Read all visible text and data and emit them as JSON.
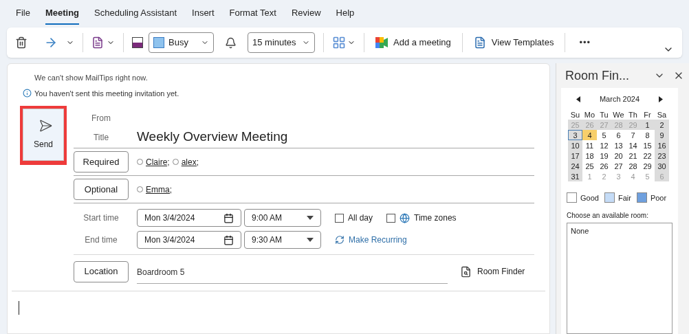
{
  "menu_tabs": [
    {
      "label": "File",
      "selected": false
    },
    {
      "label": "Meeting",
      "selected": true
    },
    {
      "label": "Scheduling Assistant",
      "selected": false
    },
    {
      "label": "Insert",
      "selected": false
    },
    {
      "label": "Format Text",
      "selected": false
    },
    {
      "label": "Review",
      "selected": false
    },
    {
      "label": "Help",
      "selected": false
    }
  ],
  "ribbon": {
    "show_as": {
      "value": "Busy",
      "color": "#8fc3ee"
    },
    "reminder": {
      "value": "15 minutes"
    },
    "add_meeting": "Add a meeting",
    "view_templates": "View Templates",
    "more": "•••"
  },
  "mailtips": {
    "notice": "We can't show MailTips right now.",
    "info": "You haven't sent this meeting invitation yet."
  },
  "send_button": {
    "label": "Send",
    "highlighted": true
  },
  "form": {
    "from_label": "From",
    "title_label": "Title",
    "title_value": "Weekly Overview Meeting",
    "required": {
      "label": "Required",
      "attendees": [
        "Claire;",
        "alex;"
      ]
    },
    "optional": {
      "label": "Optional",
      "attendees": [
        "Emma;"
      ]
    },
    "start_label": "Start time",
    "start_date": "Mon 3/4/2024",
    "start_time": "9:00 AM",
    "end_label": "End time",
    "end_date": "Mon 3/4/2024",
    "end_time": "9:30 AM",
    "all_day": {
      "label": "All day",
      "checked": false
    },
    "time_zones": {
      "label": "Time zones",
      "checked": false
    },
    "make_recurring": "Make Recurring",
    "location_label": "Location",
    "location_value": "Boardroom 5",
    "room_finder": "Room Finder"
  },
  "room_finder": {
    "title": "Room Fin...",
    "month": "March 2024",
    "weekdays": [
      "Su",
      "Mo",
      "Tu",
      "We",
      "Th",
      "Fr",
      "Sa"
    ],
    "weeks": [
      [
        {
          "label": "25",
          "muted": true,
          "shaded": true,
          "selected": false,
          "today": false
        },
        {
          "label": "26",
          "muted": true,
          "shaded": true,
          "selected": false,
          "today": false
        },
        {
          "label": "27",
          "muted": true,
          "shaded": true,
          "selected": false,
          "today": false
        },
        {
          "label": "28",
          "muted": true,
          "shaded": true,
          "selected": false,
          "today": false
        },
        {
          "label": "29",
          "muted": true,
          "shaded": true,
          "selected": false,
          "today": false
        },
        {
          "label": "1",
          "muted": false,
          "shaded": true,
          "selected": false,
          "today": false
        },
        {
          "label": "2",
          "muted": false,
          "shaded": true,
          "selected": false,
          "today": false
        }
      ],
      [
        {
          "label": "3",
          "muted": false,
          "shaded": true,
          "selected": true,
          "today": false
        },
        {
          "label": "4",
          "muted": false,
          "shaded": false,
          "selected": false,
          "today": true
        },
        {
          "label": "5",
          "muted": false,
          "shaded": false,
          "selected": false,
          "today": false
        },
        {
          "label": "6",
          "muted": false,
          "shaded": false,
          "selected": false,
          "today": false
        },
        {
          "label": "7",
          "muted": false,
          "shaded": false,
          "selected": false,
          "today": false
        },
        {
          "label": "8",
          "muted": false,
          "shaded": false,
          "selected": false,
          "today": false
        },
        {
          "label": "9",
          "muted": false,
          "shaded": true,
          "selected": false,
          "today": false
        }
      ],
      [
        {
          "label": "10",
          "muted": false,
          "shaded": true,
          "selected": false,
          "today": false
        },
        {
          "label": "11",
          "muted": false,
          "shaded": false,
          "selected": false,
          "today": false
        },
        {
          "label": "12",
          "muted": false,
          "shaded": false,
          "selected": false,
          "today": false
        },
        {
          "label": "13",
          "muted": false,
          "shaded": false,
          "selected": false,
          "today": false
        },
        {
          "label": "14",
          "muted": false,
          "shaded": false,
          "selected": false,
          "today": false
        },
        {
          "label": "15",
          "muted": false,
          "shaded": false,
          "selected": false,
          "today": false
        },
        {
          "label": "16",
          "muted": false,
          "shaded": true,
          "selected": false,
          "today": false
        }
      ],
      [
        {
          "label": "17",
          "muted": false,
          "shaded": true,
          "selected": false,
          "today": false
        },
        {
          "label": "18",
          "muted": false,
          "shaded": false,
          "selected": false,
          "today": false
        },
        {
          "label": "19",
          "muted": false,
          "shaded": false,
          "selected": false,
          "today": false
        },
        {
          "label": "20",
          "muted": false,
          "shaded": false,
          "selected": false,
          "today": false
        },
        {
          "label": "21",
          "muted": false,
          "shaded": false,
          "selected": false,
          "today": false
        },
        {
          "label": "22",
          "muted": false,
          "shaded": false,
          "selected": false,
          "today": false
        },
        {
          "label": "23",
          "muted": false,
          "shaded": true,
          "selected": false,
          "today": false
        }
      ],
      [
        {
          "label": "24",
          "muted": false,
          "shaded": true,
          "selected": false,
          "today": false
        },
        {
          "label": "25",
          "muted": false,
          "shaded": false,
          "selected": false,
          "today": false
        },
        {
          "label": "26",
          "muted": false,
          "shaded": false,
          "selected": false,
          "today": false
        },
        {
          "label": "27",
          "muted": false,
          "shaded": false,
          "selected": false,
          "today": false
        },
        {
          "label": "28",
          "muted": false,
          "shaded": false,
          "selected": false,
          "today": false
        },
        {
          "label": "29",
          "muted": false,
          "shaded": false,
          "selected": false,
          "today": false
        },
        {
          "label": "30",
          "muted": false,
          "shaded": true,
          "selected": false,
          "today": false
        }
      ],
      [
        {
          "label": "31",
          "muted": false,
          "shaded": true,
          "selected": false,
          "today": false
        },
        {
          "label": "1",
          "muted": true,
          "shaded": false,
          "selected": false,
          "today": false
        },
        {
          "label": "2",
          "muted": true,
          "shaded": false,
          "selected": false,
          "today": false
        },
        {
          "label": "3",
          "muted": true,
          "shaded": false,
          "selected": false,
          "today": false
        },
        {
          "label": "4",
          "muted": true,
          "shaded": false,
          "selected": false,
          "today": false
        },
        {
          "label": "5",
          "muted": true,
          "shaded": false,
          "selected": false,
          "today": false
        },
        {
          "label": "6",
          "muted": true,
          "shaded": true,
          "selected": false,
          "today": false
        }
      ]
    ],
    "legend": [
      {
        "label": "Good",
        "color": "#ffffff"
      },
      {
        "label": "Fair",
        "color": "#c5dcf7"
      },
      {
        "label": "Poor",
        "color": "#6fa0de"
      }
    ],
    "room_prompt": "Choose an available room:",
    "rooms": [
      "None"
    ]
  }
}
